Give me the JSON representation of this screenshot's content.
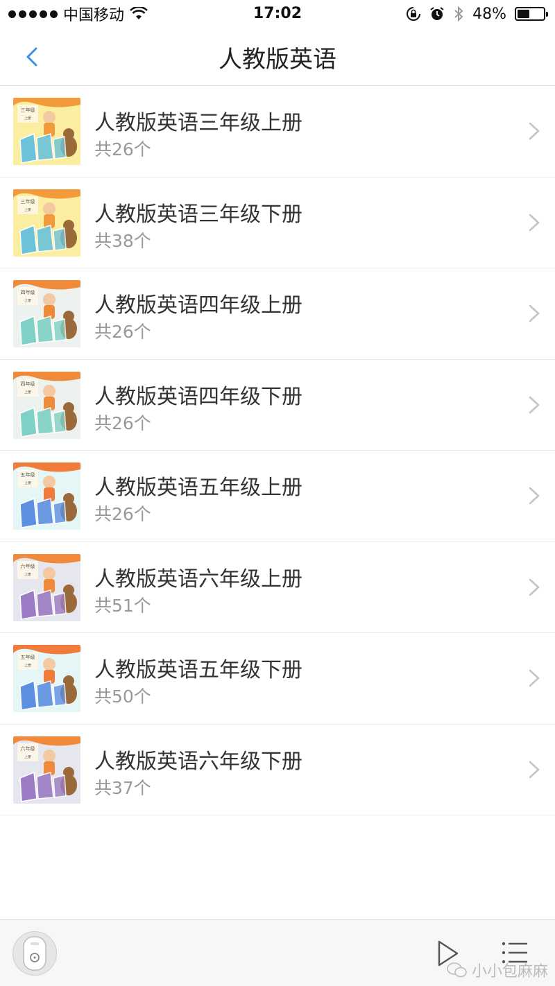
{
  "status_bar": {
    "carrier": "中国移动",
    "time": "17:02",
    "battery_text": "48%",
    "battery_level": 0.48
  },
  "nav": {
    "title": "人教版英语",
    "back_icon": "chevron-left-icon"
  },
  "books": [
    {
      "title": "人教版英语三年级上册",
      "count": "共26个",
      "cover_grade": "三年级",
      "cover_term": "上册",
      "palette": {
        "bg": "#fbeea0",
        "accent": "#f39a3b",
        "block": "#6cc3d9"
      }
    },
    {
      "title": "人教版英语三年级下册",
      "count": "共38个",
      "cover_grade": "三年级",
      "cover_term": "上册",
      "palette": {
        "bg": "#fbeea0",
        "accent": "#f39a3b",
        "block": "#6cc3d9"
      }
    },
    {
      "title": "人教版英语四年级上册",
      "count": "共26个",
      "cover_grade": "四年级",
      "cover_term": "上册",
      "palette": {
        "bg": "#eef2ee",
        "accent": "#ef8a3a",
        "block": "#7fd0c5"
      }
    },
    {
      "title": "人教版英语四年级下册",
      "count": "共26个",
      "cover_grade": "四年级",
      "cover_term": "上册",
      "palette": {
        "bg": "#eef2ee",
        "accent": "#ef8a3a",
        "block": "#7fd0c5"
      }
    },
    {
      "title": "人教版英语五年级上册",
      "count": "共26个",
      "cover_grade": "五年级",
      "cover_term": "上册",
      "palette": {
        "bg": "#e4f6f6",
        "accent": "#f07b3a",
        "block": "#5d8fe0"
      }
    },
    {
      "title": "人教版英语六年级上册",
      "count": "共51个",
      "cover_grade": "六年级",
      "cover_term": "上册",
      "palette": {
        "bg": "#e6e6ef",
        "accent": "#f08a3a",
        "block": "#9b7cc4"
      }
    },
    {
      "title": "人教版英语五年级下册",
      "count": "共50个",
      "cover_grade": "五年级",
      "cover_term": "上册",
      "palette": {
        "bg": "#e4f6f6",
        "accent": "#f07b3a",
        "block": "#5d8fe0"
      }
    },
    {
      "title": "人教版英语六年级下册",
      "count": "共37个",
      "cover_grade": "六年级",
      "cover_term": "上册",
      "palette": {
        "bg": "#e6e6ef",
        "accent": "#f08a3a",
        "block": "#9b7cc4"
      }
    }
  ],
  "bottom_bar": {
    "play_icon": "play-icon",
    "playlist_icon": "playlist-icon",
    "watermark": "小小包麻麻"
  },
  "colors": {
    "accent_blue": "#3d8fe6",
    "chevron": "#c4c4c4",
    "title_text": "#333333",
    "count_text": "#999999"
  }
}
